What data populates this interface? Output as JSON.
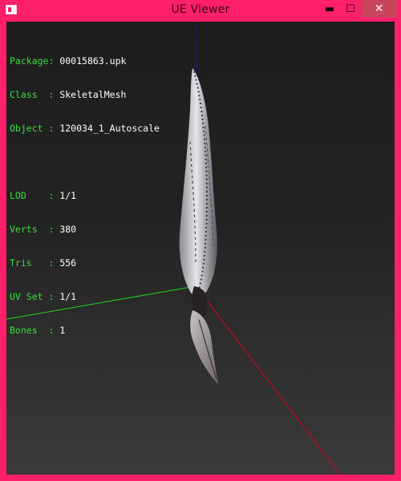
{
  "window": {
    "title": "UE Viewer",
    "controls": {
      "minimize": "▬",
      "maximize": "☐",
      "close": "✕"
    }
  },
  "info": [
    {
      "key": "Package",
      "sep": ": ",
      "value": "00015863.upk"
    },
    {
      "key": "Class  ",
      "sep": ": ",
      "value": "SkeletalMesh"
    },
    {
      "key": "Object ",
      "sep": ": ",
      "value": "120034_1_Autoscale"
    },
    {
      "key": "LOD    ",
      "sep": ": ",
      "value": "1/1"
    },
    {
      "key": "Verts  ",
      "sep": ": ",
      "value": "380"
    },
    {
      "key": "Tris   ",
      "sep": ": ",
      "value": "556"
    },
    {
      "key": "UV Set ",
      "sep": ": ",
      "value": "1/1"
    },
    {
      "key": "Bones  ",
      "sep": ": ",
      "value": "1"
    }
  ],
  "colors": {
    "frame": "#ff1f6a",
    "label": "#39e039",
    "value": "#ffffff",
    "axis_x": "#d4001a",
    "axis_y": "#22dd22",
    "axis_z": "#1010c0"
  }
}
